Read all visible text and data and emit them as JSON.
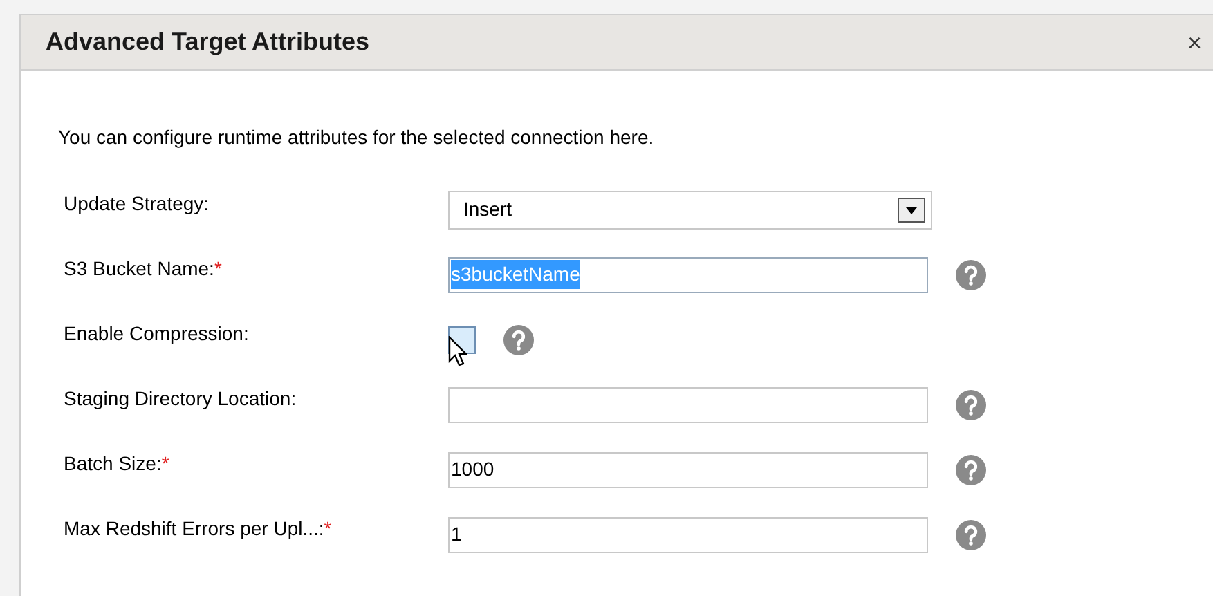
{
  "dialog": {
    "title": "Advanced Target Attributes",
    "close": "×",
    "intro": "You can configure runtime attributes for the selected connection here.",
    "fields": [
      {
        "kind": "select",
        "label": "Update Strategy:",
        "value": "Insert",
        "help": false
      },
      {
        "kind": "text",
        "label": "S3 Bucket Name:",
        "required_mark": "*",
        "value": "s3bucketName",
        "highlighted": true,
        "help": true
      },
      {
        "kind": "checkbox",
        "label": "Enable Compression:",
        "checked": false,
        "help": true
      },
      {
        "kind": "text",
        "label": "Staging Directory Location:",
        "help": true
      },
      {
        "kind": "text",
        "label": "Batch Size:",
        "required_mark": "*",
        "value": "1000",
        "highlighted": false,
        "help": true
      },
      {
        "kind": "text",
        "label": "Max Redshift Errors per Upl...:",
        "required_mark": "*",
        "value": "1",
        "highlighted": false,
        "help": true
      }
    ]
  }
}
